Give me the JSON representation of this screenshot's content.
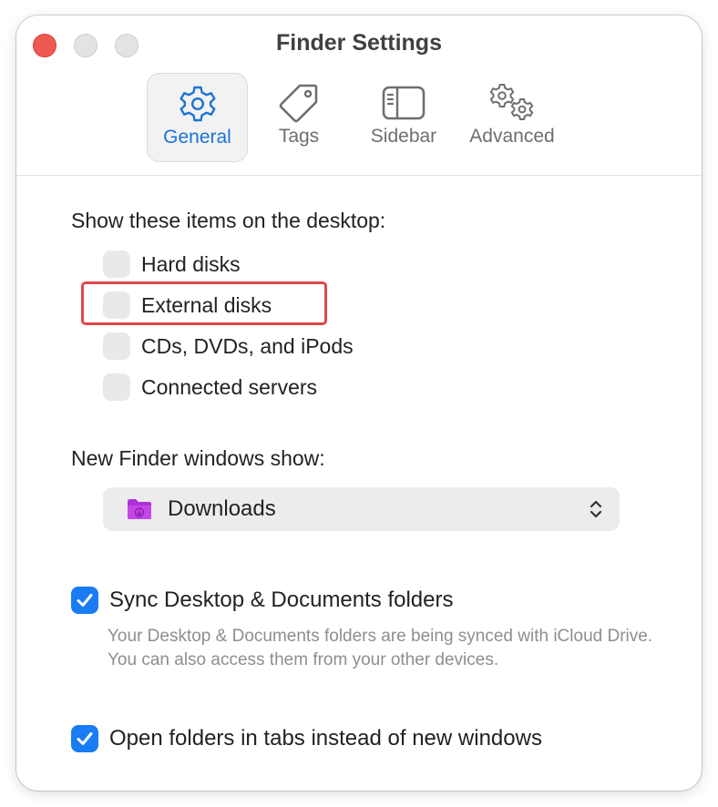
{
  "window": {
    "title": "Finder Settings"
  },
  "toolbar": {
    "tabs": [
      {
        "label": "General",
        "icon": "gear-icon",
        "selected": true
      },
      {
        "label": "Tags",
        "icon": "tag-icon",
        "selected": false
      },
      {
        "label": "Sidebar",
        "icon": "sidebar-icon",
        "selected": false
      },
      {
        "label": "Advanced",
        "icon": "gears-icon",
        "selected": false
      }
    ]
  },
  "desktop_items": {
    "heading": "Show these items on the desktop:",
    "options": [
      {
        "label": "Hard disks",
        "checked": false
      },
      {
        "label": "External disks",
        "checked": false
      },
      {
        "label": "CDs, DVDs, and iPods",
        "checked": false
      },
      {
        "label": "Connected servers",
        "checked": false
      }
    ]
  },
  "new_windows": {
    "heading": "New Finder windows show:",
    "selected": "Downloads",
    "icon": "folder-icon",
    "folder_color": "#b030d8"
  },
  "sync": {
    "label": "Sync Desktop & Documents folders",
    "checked": true,
    "description": "Your Desktop & Documents folders are being synced with iCloud Drive. You can also access them from your other devices."
  },
  "tabs_option": {
    "label": "Open folders in tabs instead of new windows",
    "checked": true
  },
  "colors": {
    "accent": "#1a7cf2",
    "close_button": "#ee5a52",
    "highlight": "#e0484b"
  }
}
